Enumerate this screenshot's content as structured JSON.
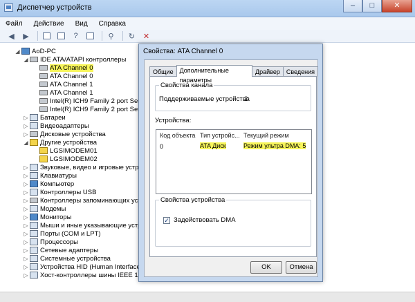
{
  "window": {
    "title": "Диспетчер устройств"
  },
  "menu": [
    "Файл",
    "Действие",
    "Вид",
    "Справка"
  ],
  "tree": {
    "root": "AoD-PC",
    "nodes": [
      {
        "label": "IDE ATA/ATAPI контроллеры",
        "expanded": true
      },
      {
        "label": "ATA Channel 0",
        "highlight": true
      },
      {
        "label": "ATA Channel 0"
      },
      {
        "label": "ATA Channel 1"
      },
      {
        "label": "ATA Channel 1"
      },
      {
        "label": "Intel(R) ICH9 Family 2 port Serial A"
      },
      {
        "label": "Intel(R) ICH9 Family 2 port Serial A"
      },
      {
        "label": "Батареи"
      },
      {
        "label": "Видеоадаптеры"
      },
      {
        "label": "Дисковые устройства"
      },
      {
        "label": "Другие устройства",
        "expanded": true
      },
      {
        "label": "LGSIMODEM01"
      },
      {
        "label": "LGSIMODEM02"
      },
      {
        "label": "Звуковые, видео и игровые устройс"
      },
      {
        "label": "Клавиатуры"
      },
      {
        "label": "Компьютер"
      },
      {
        "label": "Контроллеры USB"
      },
      {
        "label": "Контроллеры запоминающих устройс"
      },
      {
        "label": "Модемы"
      },
      {
        "label": "Мониторы"
      },
      {
        "label": "Мыши и иные указывающие устройс"
      },
      {
        "label": "Порты (COM и LPT)"
      },
      {
        "label": "Процессоры"
      },
      {
        "label": "Сетевые адаптеры"
      },
      {
        "label": "Системные устройства"
      },
      {
        "label": "Устройства HID (Human Interface De"
      },
      {
        "label": "Хост-контроллеры шины IEEE 1394"
      }
    ]
  },
  "dialog": {
    "title": "Свойства: ATA Channel 0",
    "tabs": [
      "Общие",
      "Дополнительные параметры",
      "Драйвер",
      "Сведения"
    ],
    "group_channel": "Свойства канала",
    "supported_label": "Поддерживаемые устройства",
    "supported_value": "2",
    "group_devices": "Устройства:",
    "columns": [
      "Код объекта",
      "Тип устройс...",
      "Текущий режим"
    ],
    "row": {
      "code": "0",
      "type": "ATA Диск",
      "mode": "Режим ультра DMA: 5"
    },
    "group_device_props": "Свойства устройства",
    "dma_label": "Задействовать DMA",
    "dma_checked": "✓",
    "ok": "OK",
    "cancel": "Отмена"
  }
}
